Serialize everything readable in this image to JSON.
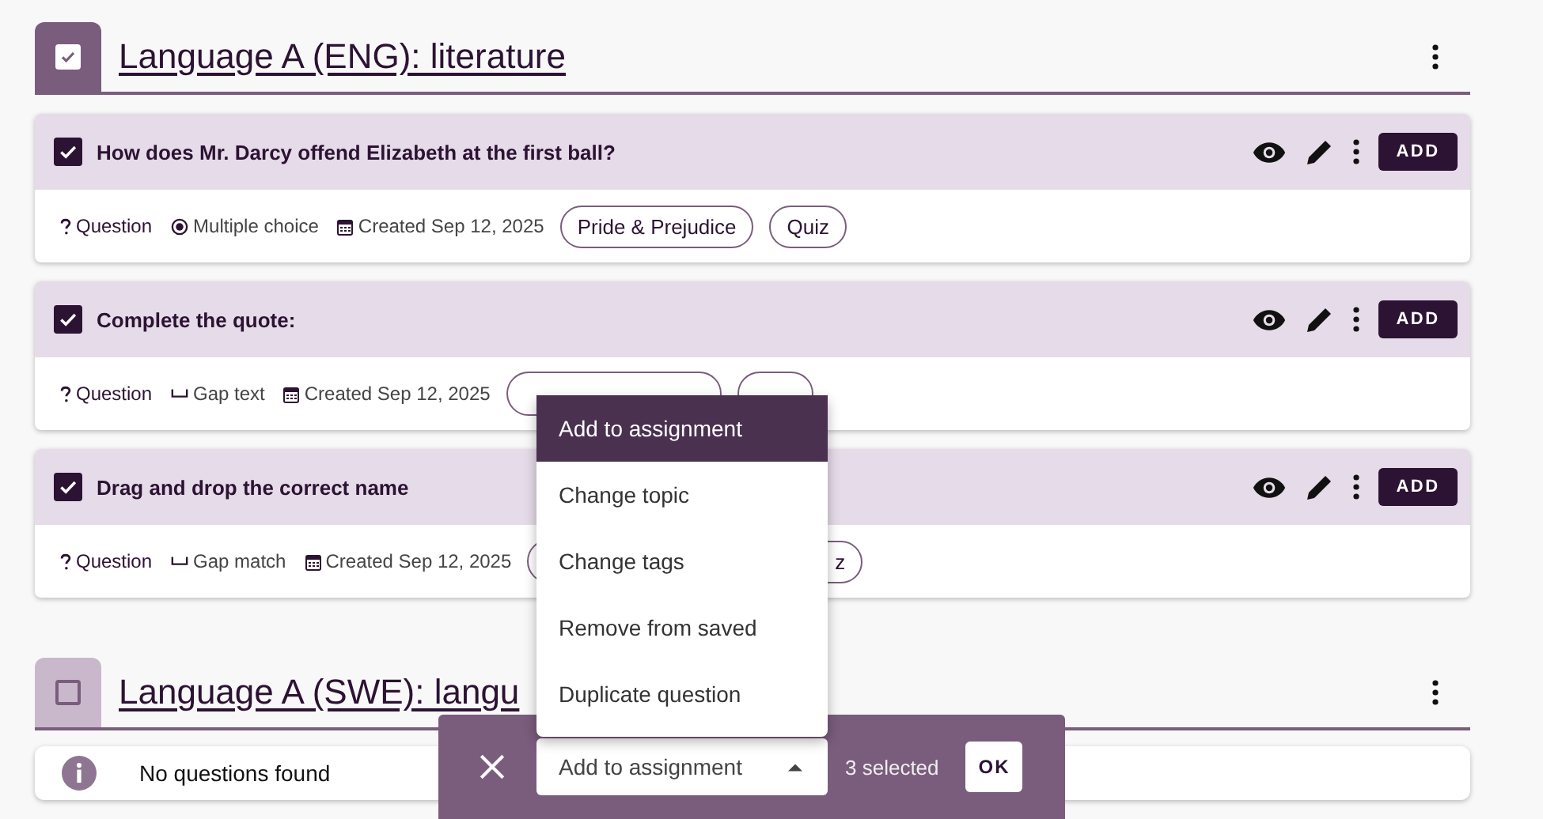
{
  "sections": [
    {
      "title": "Language A (ENG): literature",
      "checked": true,
      "questions": [
        {
          "text": "How does Mr. Darcy offend Elizabeth at the first ball?",
          "checked": true,
          "add_label": "ADD",
          "meta": "Question",
          "type": {
            "kind": "multiple_choice",
            "label": "Multiple choice"
          },
          "created": "Created Sep 12, 2025",
          "tags": [
            {
              "label": "Pride & Prejudice",
              "covered": false
            },
            {
              "label": "Quiz",
              "covered": false
            }
          ]
        },
        {
          "text": "Complete the quote:",
          "checked": true,
          "add_label": "ADD",
          "meta": "Question",
          "type": {
            "kind": "gap",
            "label": "Gap text"
          },
          "created": "Created Sep 12, 2025",
          "tags": [
            {
              "covered": true
            },
            {
              "covered": true
            }
          ]
        },
        {
          "text": "Drag and drop the correct name",
          "checked": true,
          "add_label": "ADD",
          "meta": "Question",
          "type": {
            "kind": "gap",
            "label": "Gap match"
          },
          "created": "Created Sep 12, 2025",
          "tags": [
            {
              "covered": true
            },
            {
              "label": "z",
              "covered": false,
              "clipped": true
            }
          ]
        }
      ]
    },
    {
      "title": "Language A (SWE): langu",
      "checked": false,
      "empty_message": "No questions found"
    }
  ],
  "menu": {
    "items": [
      {
        "label": "Add to assignment",
        "selected": true
      },
      {
        "label": "Change topic",
        "selected": false
      },
      {
        "label": "Change tags",
        "selected": false
      },
      {
        "label": "Remove from saved",
        "selected": false
      },
      {
        "label": "Duplicate question",
        "selected": false
      }
    ]
  },
  "action_bar": {
    "select_value": "Add to assignment",
    "count": "3 selected",
    "ok": "OK"
  }
}
